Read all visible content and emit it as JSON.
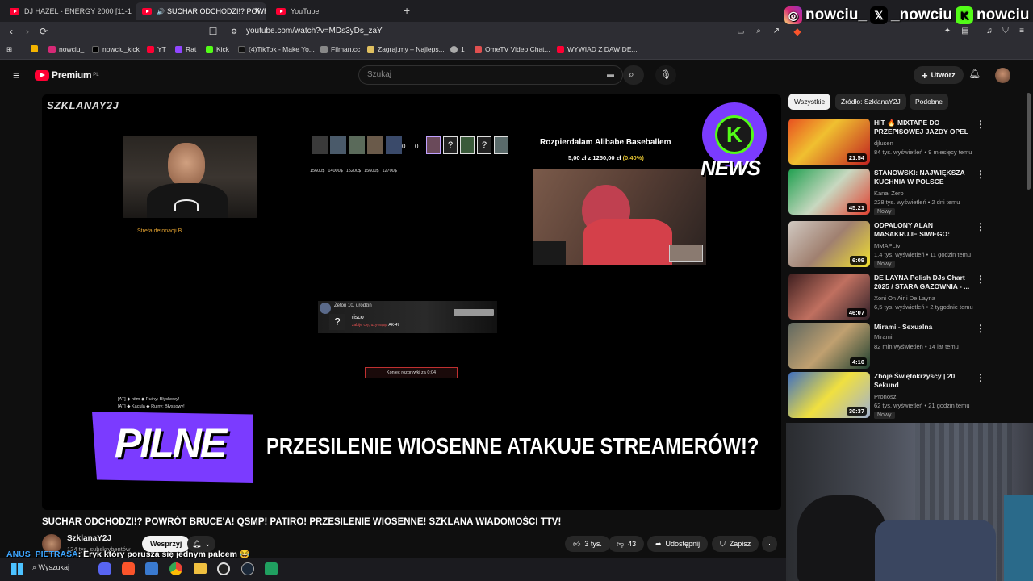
{
  "browser": {
    "tabs": [
      {
        "label": "DJ HAZEL - ENERGY 2000 [11-11"
      },
      {
        "label": "SUCHAR ODCHODZI!? POWR"
      },
      {
        "label": "YouTube"
      }
    ],
    "url": "youtube.com/watch?v=MDs3yDs_zaY",
    "bookmarks": [
      "nowciu_",
      "nowciu_kick",
      "YT",
      "Rat",
      "Kick",
      "(4)TikTok - Make Yo...",
      "Filman.cc",
      "Zagraj.my – Najleps...",
      "1",
      "OmeTV Video Chat...",
      "WYWIAD Z DAWIDE..."
    ]
  },
  "social": {
    "instagram": "nowciu_",
    "x": "_nowciu",
    "kick": "nowciu",
    "colors": {
      "instagram": "#d62976",
      "x": "#000000",
      "kick": "#53fc18"
    }
  },
  "youtube": {
    "logo": "Premium",
    "logo_sup": "PL",
    "search_placeholder": "Szukaj",
    "create_label": "Utwórz"
  },
  "video": {
    "watermark": "SZKLANAY2J",
    "streamer_caption": "Strefa detonacji B",
    "hud_players_left": [
      "Rasola",
      "Rasowski",
      "hifm",
      "Kacula",
      "sabre1597"
    ],
    "hud_players_right": [
      "Pascal",
      "Luki2",
      "risco",
      "lil1917",
      "No name"
    ],
    "hud_money": [
      "15600$",
      "14000$",
      "15200$",
      "15600$",
      "12700$"
    ],
    "score_left": "0",
    "score_right": "0",
    "alibaba_title": "Rozpierdalam Alibabe Baseballem",
    "alibaba_amount": "5,00 zł z 1250,00 zł",
    "alibaba_percent": "(0.40%)",
    "news_label": "NEWS",
    "kill_top": "Żeton 10. urodzin",
    "kill_name": "risco",
    "kill_weapon": "AK-47",
    "kill_desc": "zabije cię, używając",
    "round_timer": "Koniec rozgrywki za 0:04",
    "chat_lines": [
      "[AT] ◆ hifm ◆ Ruiny: Błyskowy!",
      "[AT] ◆ Kacula ◆ Ruiny: Błyskowy!"
    ],
    "banner_label": "PILNE",
    "banner_text": "PRZESILENIE WIOSENNE ATAKUJE STREAMERÓW!?"
  },
  "watch": {
    "title": "SUCHAR ODCHODZI!? POWRÓT BRUCE'A! QSMP! PATIRO! PRZESILENIE WIOSENNE! SZKLANA WIADOMOŚCI TTV!",
    "channel": "SzklanaY2J",
    "subscribers": "124 tys. subskrybentów",
    "support_label": "Wesprzyj",
    "likes": "3 tys.",
    "dislikes": "43",
    "share_label": "Udostępnij",
    "save_label": "Zapisz"
  },
  "chat_overlay": {
    "user": "ANUS_PIETRASA",
    "message": ": Eryk który porusza się jednym palcem 😂",
    "user_color": "#3ea6ff"
  },
  "sidebar": {
    "chips": [
      "Wszystkie",
      "Źródło: SzklanaY2J",
      "Podobne"
    ],
    "items": [
      {
        "title": "HIT 🔥 MIXTAPE DO PRZEPISOWEJ JAZDY OPEL ...",
        "channel": "djlusen",
        "meta": "84 tys. wyświetleń • 9 miesięcy temu",
        "duration": "21:54",
        "new": ""
      },
      {
        "title": "STANOWSKI: NAJWIĘKSZA KUCHNIA W POLSCE",
        "channel": "Kanał Zero",
        "meta": "228 tys. wyświetleń • 2 dni temu",
        "duration": "45:21",
        "new": "Nowy"
      },
      {
        "title": "ODPALONY ALAN MASAKRUJE SIWEGO: DALEJ NIE MA JAJ, ...",
        "channel": "MMAPLtv",
        "meta": "1,4 tys. wyświetleń • 11 godzin temu",
        "duration": "6:09",
        "new": "Nowy"
      },
      {
        "title": "DE LAYNA Polish DJs Chart 2025 / STARA GAZOWNIA - ...",
        "channel": "Xoni On Air i De Layna",
        "meta": "6,5 tys. wyświetleń • 2 tygodnie temu",
        "duration": "46:07",
        "new": ""
      },
      {
        "title": "Mirami - Sexualna",
        "channel": "Mirami",
        "meta": "82 mln wyświetleń • 14 lat temu",
        "duration": "4:10",
        "new": ""
      },
      {
        "title": "Zbóje Świętokrzyscy | 20 Sekund",
        "channel": "Pronosz",
        "meta": "62 tys. wyświetleń • 21 godzin temu",
        "duration": "30:37",
        "new": "Nowy"
      }
    ]
  },
  "taskbar": {
    "search_label": "Wyszukaj"
  }
}
